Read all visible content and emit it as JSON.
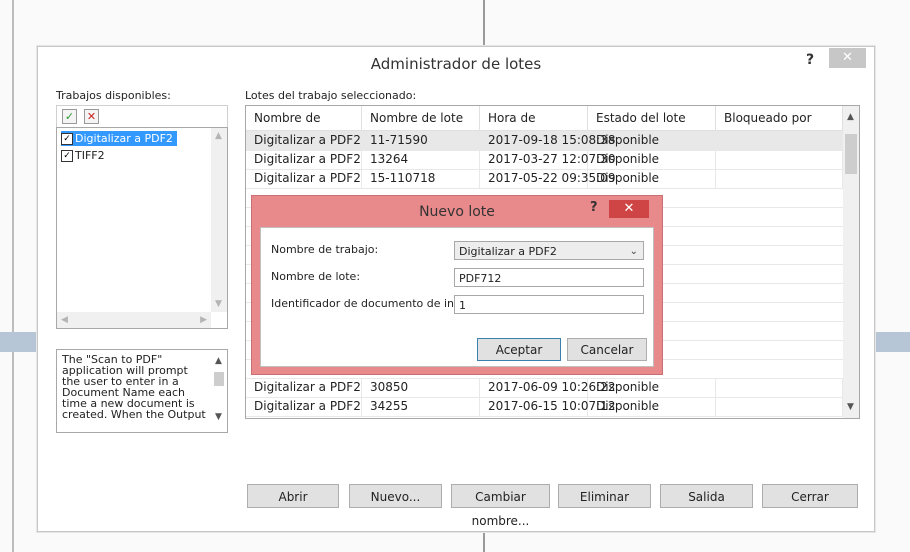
{
  "window": {
    "title": "Administrador de lotes",
    "help": "?",
    "close": "✕"
  },
  "left": {
    "label": "Trabajos disponibles:",
    "jobs": [
      {
        "label": "Digitalizar a PDF2",
        "checked": "✓"
      },
      {
        "label": "TIFF2",
        "checked": "✓"
      }
    ],
    "description": "The \"Scan to PDF\" application will prompt the user to enter in a Document Name each time a new document is created. When the Output"
  },
  "table": {
    "label": "Lotes del trabajo seleccionado:",
    "columns": [
      "Nombre de trabajo",
      "Nombre de lote",
      "Hora de creación",
      "Estado del lote",
      "Bloqueado por"
    ],
    "rows": [
      [
        "Digitalizar a PDF2",
        "11-71590",
        "2017-09-18 15:08:38",
        "Disponible",
        ""
      ],
      [
        "Digitalizar a PDF2",
        "13264",
        "2017-03-27 12:07:30",
        "Disponible",
        ""
      ],
      [
        "Digitalizar a PDF2",
        "15-110718",
        "2017-05-22 09:35:09",
        "Disponible",
        ""
      ],
      [
        "Digitalizar a PDF2",
        "30850",
        "2017-06-09 10:26:22",
        "Disponible",
        ""
      ],
      [
        "Digitalizar a PDF2",
        "34255",
        "2017-06-15 10:07:12",
        "Disponible",
        ""
      ]
    ]
  },
  "buttons": {
    "open": "Abrir",
    "new": "Nuevo...",
    "rename": "Cambiar nombre...",
    "delete": "Eliminar",
    "exit": "Salida",
    "close": "Cerrar"
  },
  "modal": {
    "title": "Nuevo lote",
    "help": "?",
    "close": "✕",
    "job_label": "Nombre de trabajo:",
    "job_value": "Digitalizar a PDF2",
    "batch_label": "Nombre de lote:",
    "batch_value": "PDF712",
    "docid_label": "Identificador de documento de inicio:",
    "docid_value": "1",
    "accept": "Aceptar",
    "cancel": "Cancelar"
  },
  "colors": {
    "selection": "#3399ff",
    "modal_frame": "#e8898b",
    "modal_close": "#cf4444"
  }
}
